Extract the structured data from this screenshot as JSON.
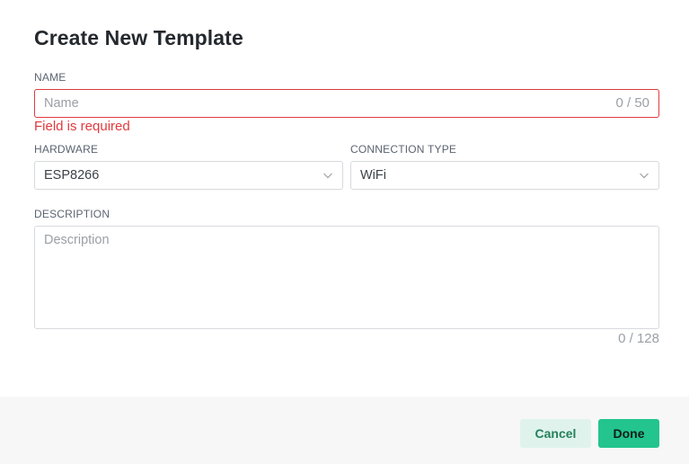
{
  "dialog": {
    "title": "Create New Template"
  },
  "name_field": {
    "label": "NAME",
    "placeholder": "Name",
    "value": "",
    "counter": "0 / 50",
    "error": "Field is required"
  },
  "hardware_field": {
    "label": "HARDWARE",
    "value": "ESP8266"
  },
  "connection_field": {
    "label": "CONNECTION TYPE",
    "value": "WiFi"
  },
  "description_field": {
    "label": "DESCRIPTION",
    "placeholder": "Description",
    "value": "",
    "counter": "0 / 128"
  },
  "footer": {
    "cancel_label": "Cancel",
    "done_label": "Done"
  },
  "colors": {
    "accent": "#23c48e",
    "error": "#e03a3e",
    "cancel_bg": "#dff3ec"
  },
  "icons": {
    "select_chevron": "chevron-down-icon"
  }
}
